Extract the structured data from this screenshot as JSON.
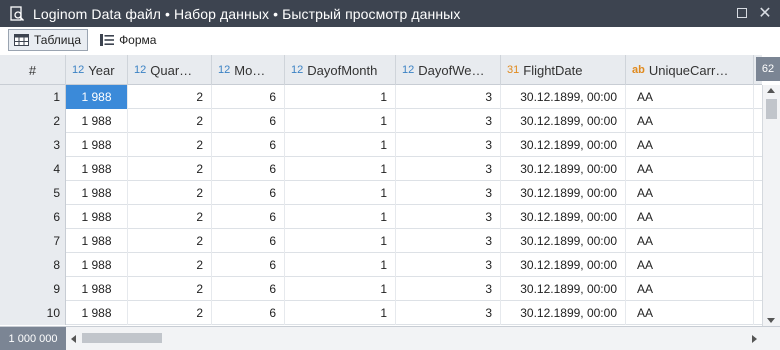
{
  "window": {
    "title": "Loginom Data файл • Набор данных • Быстрый просмотр данных"
  },
  "toolbar": {
    "tabs": [
      {
        "label": "Таблица",
        "icon": "table-icon",
        "active": true
      },
      {
        "label": "Форма",
        "icon": "form-list-icon",
        "active": false
      }
    ]
  },
  "grid": {
    "rownum_header": "#",
    "columns": [
      {
        "type_icon": "12",
        "type": "number",
        "label": "Year"
      },
      {
        "type_icon": "12",
        "type": "number",
        "label": "Quar…"
      },
      {
        "type_icon": "12",
        "type": "number",
        "label": "Mo…"
      },
      {
        "type_icon": "12",
        "type": "number",
        "label": "DayofMonth"
      },
      {
        "type_icon": "12",
        "type": "number",
        "label": "DayofWe…"
      },
      {
        "type_icon": "31",
        "type": "date",
        "label": "FlightDate"
      },
      {
        "type_icon": "ab",
        "type": "string",
        "label": "UniqueCarr…"
      }
    ],
    "hidden_columns_count": "62",
    "rows": [
      {
        "n": "1",
        "cells": [
          "1 988",
          "2",
          "6",
          "1",
          "3",
          "30.12.1899, 00:00",
          "AA"
        ]
      },
      {
        "n": "2",
        "cells": [
          "1 988",
          "2",
          "6",
          "1",
          "3",
          "30.12.1899, 00:00",
          "AA"
        ]
      },
      {
        "n": "3",
        "cells": [
          "1 988",
          "2",
          "6",
          "1",
          "3",
          "30.12.1899, 00:00",
          "AA"
        ]
      },
      {
        "n": "4",
        "cells": [
          "1 988",
          "2",
          "6",
          "1",
          "3",
          "30.12.1899, 00:00",
          "AA"
        ]
      },
      {
        "n": "5",
        "cells": [
          "1 988",
          "2",
          "6",
          "1",
          "3",
          "30.12.1899, 00:00",
          "AA"
        ]
      },
      {
        "n": "6",
        "cells": [
          "1 988",
          "2",
          "6",
          "1",
          "3",
          "30.12.1899, 00:00",
          "AA"
        ]
      },
      {
        "n": "7",
        "cells": [
          "1 988",
          "2",
          "6",
          "1",
          "3",
          "30.12.1899, 00:00",
          "AA"
        ]
      },
      {
        "n": "8",
        "cells": [
          "1 988",
          "2",
          "6",
          "1",
          "3",
          "30.12.1899, 00:00",
          "AA"
        ]
      },
      {
        "n": "9",
        "cells": [
          "1 988",
          "2",
          "6",
          "1",
          "3",
          "30.12.1899, 00:00",
          "AA"
        ]
      },
      {
        "n": "10",
        "cells": [
          "1 988",
          "2",
          "6",
          "1",
          "3",
          "30.12.1899, 00:00",
          "AA"
        ]
      }
    ],
    "total_rows": "1 000 000"
  },
  "colors": {
    "titlebar": "#3d4450",
    "selection": "#3b8ad9",
    "number_type": "#3b82c4",
    "date_string_type": "#e08a1e",
    "badge": "#7b8594"
  }
}
